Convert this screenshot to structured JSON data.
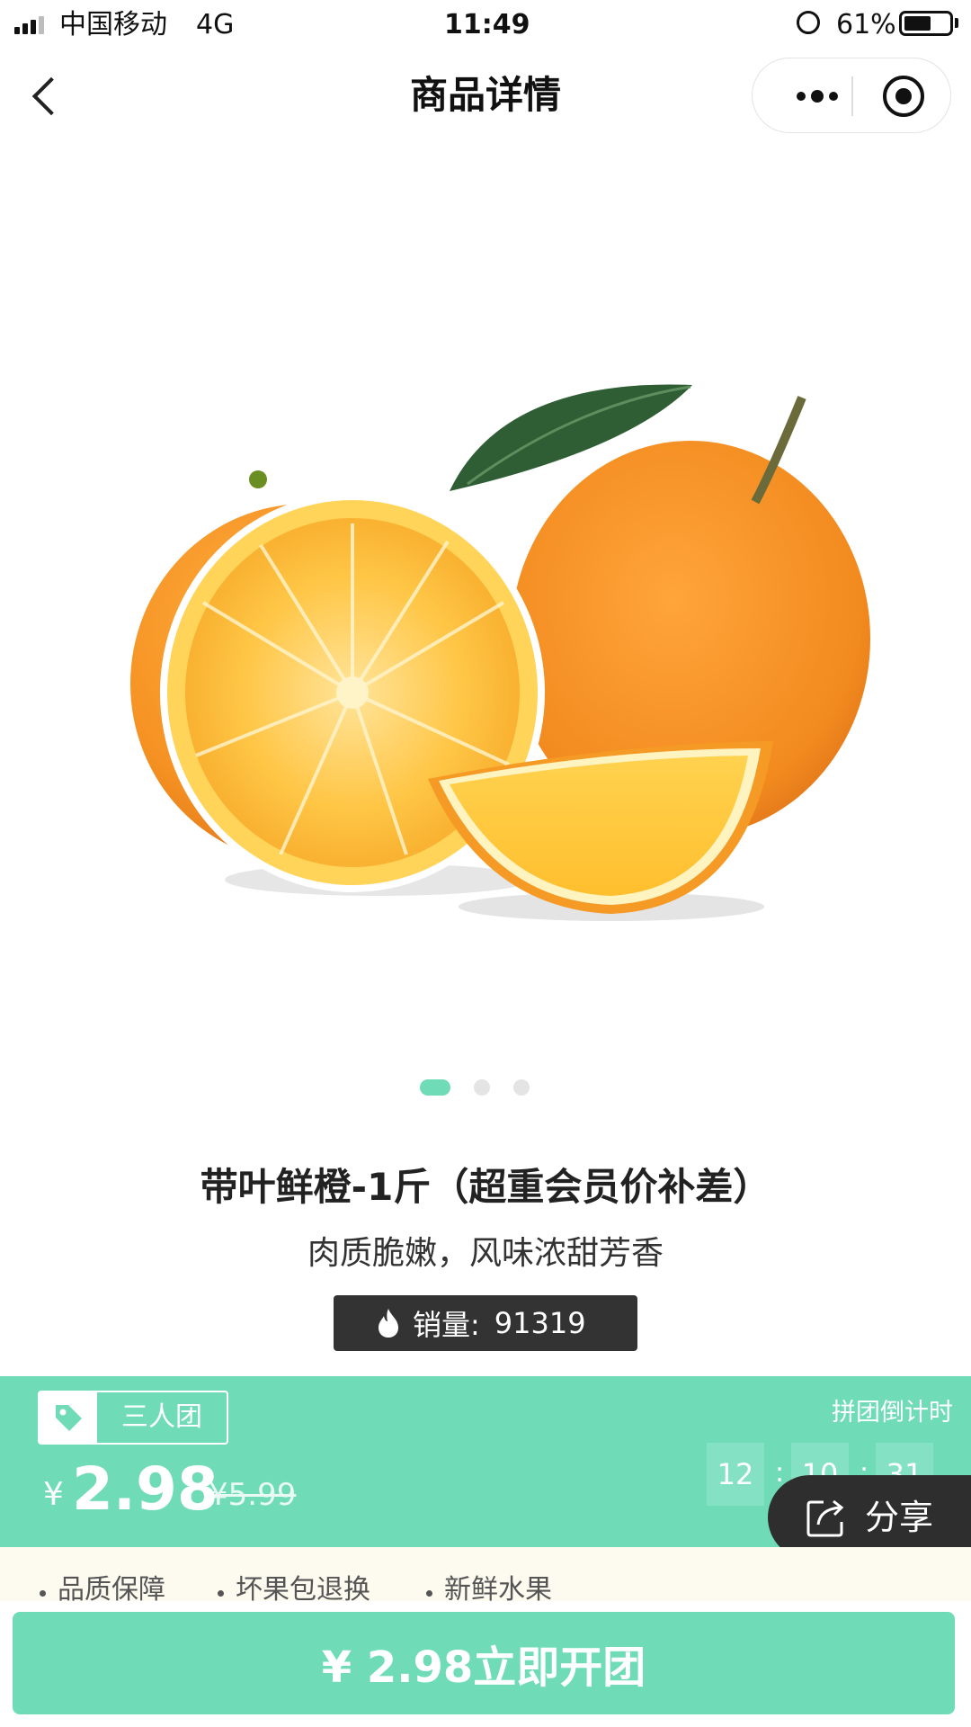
{
  "status_bar": {
    "carrier": "中国移动",
    "network": "4G",
    "time": "11:49",
    "battery": "61%",
    "battery_level": 0.61
  },
  "nav": {
    "title": "商品详情",
    "back_icon": "chevron-left-icon",
    "more_icon": "more-dots-icon",
    "close_icon": "target-circle-icon"
  },
  "carousel": {
    "page_count": 3,
    "active_index": 0
  },
  "product": {
    "title": "带叶鲜橙-1斤（超重会员价补差）",
    "subtitle": "肉质脆嫩，风味浓甜芳香",
    "sales_label": "销量:",
    "sales_value": "91319"
  },
  "group": {
    "badge_label": "三人团",
    "currency": "¥",
    "price": "2.98",
    "original_price": "¥5.99",
    "countdown_label": "拼团倒计时",
    "countdown": [
      "12",
      "10",
      "31"
    ],
    "countdown_sep": ":"
  },
  "share": {
    "label": "分享"
  },
  "guarantees": [
    "品质保障",
    "坏果包退换",
    "新鲜水果"
  ],
  "cta": {
    "label": "¥ 2.98立即开团"
  },
  "colors": {
    "accent": "#6fdcb7",
    "dark": "#333333",
    "orange": "#f39a26"
  }
}
